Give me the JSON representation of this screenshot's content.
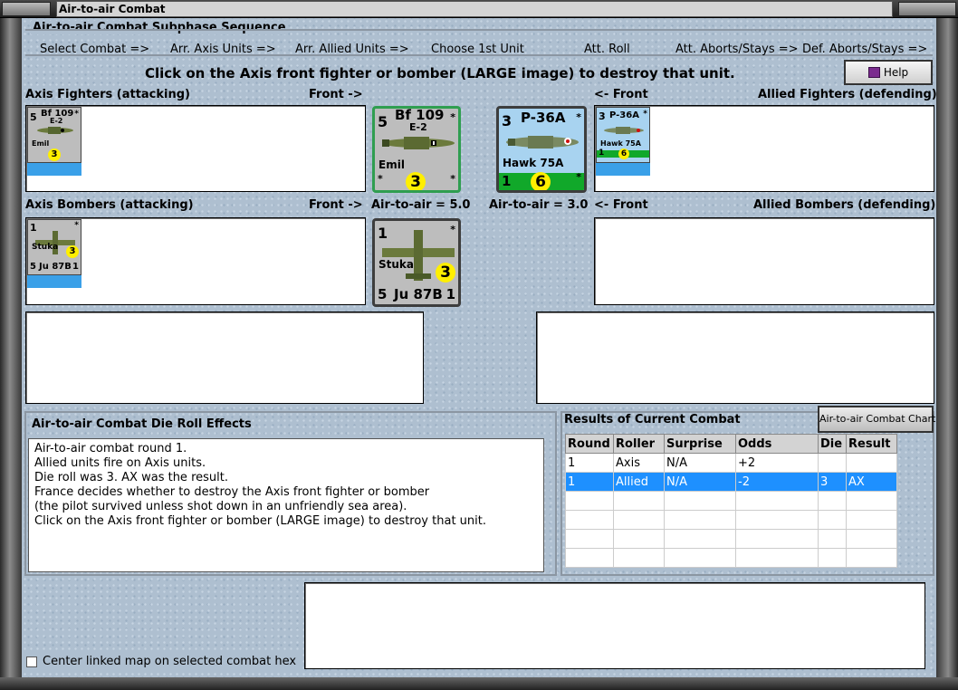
{
  "window": {
    "title": "Air-to-air Combat"
  },
  "sequence": {
    "group_label": "Air-to-air Combat Subphase Sequence",
    "steps": [
      "Select Combat =>",
      "Arr. Axis Units =>",
      "Arr. Allied Units =>",
      "Choose 1st Unit",
      "Att. Roll",
      "Att. Aborts/Stays =>",
      "Def. Aborts/Stays =>"
    ]
  },
  "instruction": "Click on the Axis front fighter or bomber (LARGE image) to destroy that unit.",
  "help_label": "Help",
  "axis_fighters": {
    "label": "Axis Fighters (attacking)",
    "front_label": "Front ->",
    "unit": {
      "left_value": "5",
      "name": "Bf 109",
      "variant": "E-2",
      "nickname": "Emil",
      "rating": "3",
      "stars": "*"
    }
  },
  "allied_fighters": {
    "label": "Allied Fighters (defending)",
    "front_label": "<- Front",
    "unit": {
      "left_value": "3",
      "name": "P-36A",
      "nickname": "Hawk 75A",
      "rating": "6",
      "bottom_left": "1",
      "stars": "*"
    }
  },
  "axis_bombers": {
    "label": "Axis Bombers (attacking)",
    "front_label": "Front ->",
    "unit": {
      "top_value": "1",
      "nickname": "Stuka",
      "rating": "3",
      "bottom_left": "5",
      "name": "Ju 87B",
      "bottom_right": "1",
      "stars": "*"
    }
  },
  "allied_bombers": {
    "label": "Allied Bombers (defending)",
    "front_label": "<- Front"
  },
  "air_to_air": {
    "axis": "Air-to-air = 5.0",
    "allied": "Air-to-air = 3.0"
  },
  "die_roll": {
    "title": "Air-to-air Combat Die Roll Effects",
    "lines": [
      "Air-to-air combat round 1.",
      "Allied units fire on Axis units.",
      "Die roll was 3.  AX was the result.",
      "France decides whether to destroy the Axis front fighter or bomber",
      "(the pilot survived unless shot down in an unfriendly sea area).",
      "Click on the Axis front fighter or bomber (LARGE image) to destroy that unit."
    ]
  },
  "results": {
    "title": "Results of Current Combat",
    "chart_button": "Air-to-air Combat Chart",
    "columns": [
      "Round",
      "Roller",
      "Surprise",
      "Odds",
      "Die",
      "Result"
    ],
    "rows": [
      [
        "1",
        "Axis",
        "N/A",
        "+2",
        "",
        ""
      ],
      [
        "1",
        "Allied",
        "N/A",
        "-2",
        "3",
        "AX"
      ]
    ]
  },
  "center_option": "Center linked map on selected combat hex",
  "colors": {
    "selected_row": "#1e90ff",
    "client_bg": "#aebfd0",
    "rating_circle": "#ffef00",
    "allied_bar": "#11a82a",
    "axis_bar": "#3aa0e8"
  }
}
